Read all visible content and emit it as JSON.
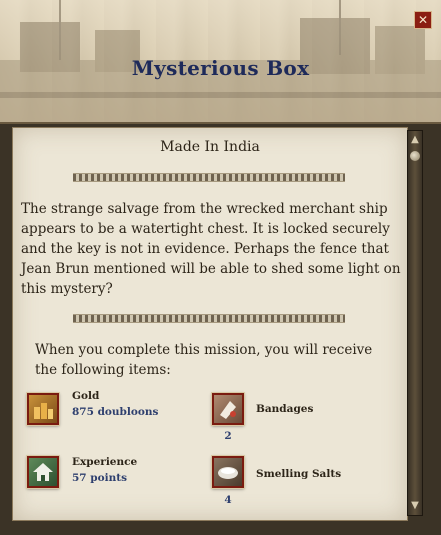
{
  "window": {
    "title": "Mysterious Box",
    "close_symbol": "✕"
  },
  "mission": {
    "origin": "Made In India",
    "description": "The strange salvage from the wrecked merchant ship appears to be a watertight chest. It is locked securely and the key is not in evidence. Perhaps the fence that Jean Brun mentioned will be able to shed some light on this mystery?",
    "rewards_intro": "When you complete this mission, you will receive the following items:"
  },
  "rewards": [
    {
      "name": "Gold",
      "value": "875 doubloons",
      "icon": "gold-icon"
    },
    {
      "name": "Bandages",
      "quantity": "2",
      "icon": "bandages-icon"
    },
    {
      "name": "Experience",
      "value": "57 points",
      "icon": "experience-icon"
    },
    {
      "name": "Smelling Salts",
      "quantity": "4",
      "icon": "smelling-salts-icon"
    }
  ],
  "scrollbar": {
    "up_symbol": "▲",
    "down_symbol": "▼"
  },
  "colors": {
    "title": "#1e2a5a",
    "panel_bg": "#ece6d6",
    "icon_border": "#7a1b10",
    "value_text": "#2e3f6e"
  }
}
